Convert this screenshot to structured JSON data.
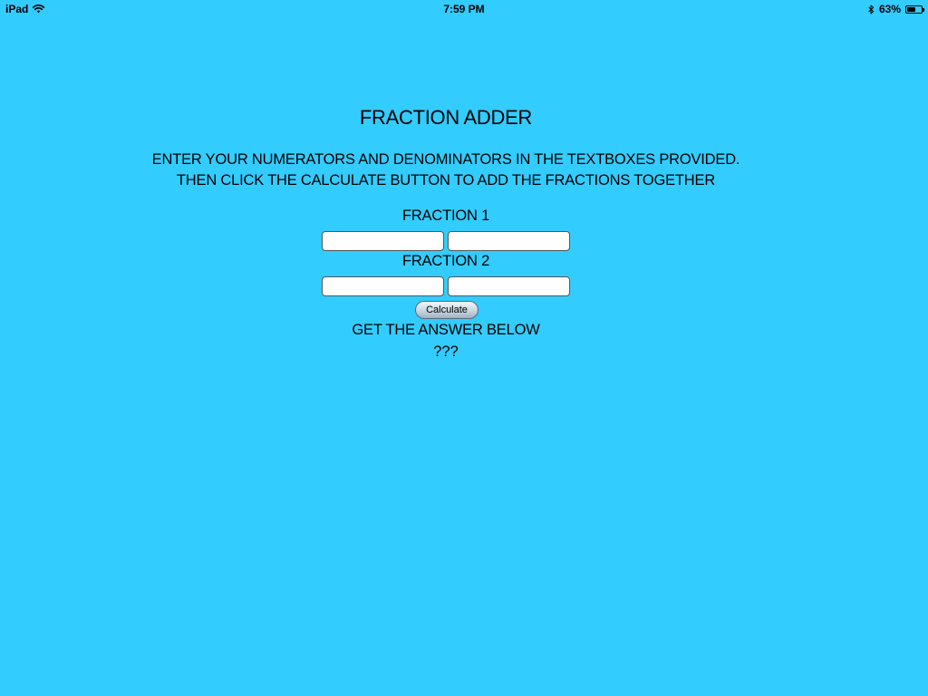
{
  "theme": {
    "background": "#33CCFF",
    "text": "#000000"
  },
  "status_bar": {
    "device": "iPad",
    "time": "7:59 PM",
    "battery_text": "63%",
    "battery_level": 0.63,
    "icons": [
      "wifi-icon",
      "bluetooth-icon",
      "battery-icon"
    ]
  },
  "app": {
    "title": "FRACTION ADDER",
    "instructions": [
      "ENTER YOUR NUMERATORS AND DENOMINATORS IN THE TEXTBOXES PROVIDED.",
      "THEN CLICK THE CALCULATE BUTTON TO ADD THE FRACTIONS TOGETHER"
    ],
    "fraction1": {
      "label": "FRACTION 1",
      "numerator_value": "",
      "denominator_value": ""
    },
    "fraction2": {
      "label": "FRACTION 2",
      "numerator_value": "",
      "denominator_value": ""
    },
    "calculate_label": "Calculate",
    "answer_heading": "GET THE ANSWER BELOW",
    "answer_value": "???"
  }
}
